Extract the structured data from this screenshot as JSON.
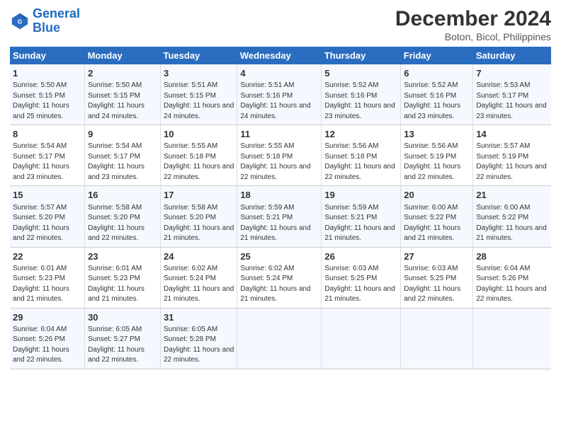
{
  "logo": {
    "line1": "General",
    "line2": "Blue"
  },
  "title": "December 2024",
  "subtitle": "Boton, Bicol, Philippines",
  "days_of_week": [
    "Sunday",
    "Monday",
    "Tuesday",
    "Wednesday",
    "Thursday",
    "Friday",
    "Saturday"
  ],
  "weeks": [
    [
      {
        "num": "1",
        "sunrise": "5:50 AM",
        "sunset": "5:15 PM",
        "daylight": "11 hours and 25 minutes."
      },
      {
        "num": "2",
        "sunrise": "5:50 AM",
        "sunset": "5:15 PM",
        "daylight": "11 hours and 24 minutes."
      },
      {
        "num": "3",
        "sunrise": "5:51 AM",
        "sunset": "5:15 PM",
        "daylight": "11 hours and 24 minutes."
      },
      {
        "num": "4",
        "sunrise": "5:51 AM",
        "sunset": "5:16 PM",
        "daylight": "11 hours and 24 minutes."
      },
      {
        "num": "5",
        "sunrise": "5:52 AM",
        "sunset": "5:16 PM",
        "daylight": "11 hours and 23 minutes."
      },
      {
        "num": "6",
        "sunrise": "5:52 AM",
        "sunset": "5:16 PM",
        "daylight": "11 hours and 23 minutes."
      },
      {
        "num": "7",
        "sunrise": "5:53 AM",
        "sunset": "5:17 PM",
        "daylight": "11 hours and 23 minutes."
      }
    ],
    [
      {
        "num": "8",
        "sunrise": "5:54 AM",
        "sunset": "5:17 PM",
        "daylight": "11 hours and 23 minutes."
      },
      {
        "num": "9",
        "sunrise": "5:54 AM",
        "sunset": "5:17 PM",
        "daylight": "11 hours and 23 minutes."
      },
      {
        "num": "10",
        "sunrise": "5:55 AM",
        "sunset": "5:18 PM",
        "daylight": "11 hours and 22 minutes."
      },
      {
        "num": "11",
        "sunrise": "5:55 AM",
        "sunset": "5:18 PM",
        "daylight": "11 hours and 22 minutes."
      },
      {
        "num": "12",
        "sunrise": "5:56 AM",
        "sunset": "5:18 PM",
        "daylight": "11 hours and 22 minutes."
      },
      {
        "num": "13",
        "sunrise": "5:56 AM",
        "sunset": "5:19 PM",
        "daylight": "11 hours and 22 minutes."
      },
      {
        "num": "14",
        "sunrise": "5:57 AM",
        "sunset": "5:19 PM",
        "daylight": "11 hours and 22 minutes."
      }
    ],
    [
      {
        "num": "15",
        "sunrise": "5:57 AM",
        "sunset": "5:20 PM",
        "daylight": "11 hours and 22 minutes."
      },
      {
        "num": "16",
        "sunrise": "5:58 AM",
        "sunset": "5:20 PM",
        "daylight": "11 hours and 22 minutes."
      },
      {
        "num": "17",
        "sunrise": "5:58 AM",
        "sunset": "5:20 PM",
        "daylight": "11 hours and 21 minutes."
      },
      {
        "num": "18",
        "sunrise": "5:59 AM",
        "sunset": "5:21 PM",
        "daylight": "11 hours and 21 minutes."
      },
      {
        "num": "19",
        "sunrise": "5:59 AM",
        "sunset": "5:21 PM",
        "daylight": "11 hours and 21 minutes."
      },
      {
        "num": "20",
        "sunrise": "6:00 AM",
        "sunset": "5:22 PM",
        "daylight": "11 hours and 21 minutes."
      },
      {
        "num": "21",
        "sunrise": "6:00 AM",
        "sunset": "5:22 PM",
        "daylight": "11 hours and 21 minutes."
      }
    ],
    [
      {
        "num": "22",
        "sunrise": "6:01 AM",
        "sunset": "5:23 PM",
        "daylight": "11 hours and 21 minutes."
      },
      {
        "num": "23",
        "sunrise": "6:01 AM",
        "sunset": "5:23 PM",
        "daylight": "11 hours and 21 minutes."
      },
      {
        "num": "24",
        "sunrise": "6:02 AM",
        "sunset": "5:24 PM",
        "daylight": "11 hours and 21 minutes."
      },
      {
        "num": "25",
        "sunrise": "6:02 AM",
        "sunset": "5:24 PM",
        "daylight": "11 hours and 21 minutes."
      },
      {
        "num": "26",
        "sunrise": "6:03 AM",
        "sunset": "5:25 PM",
        "daylight": "11 hours and 21 minutes."
      },
      {
        "num": "27",
        "sunrise": "6:03 AM",
        "sunset": "5:25 PM",
        "daylight": "11 hours and 22 minutes."
      },
      {
        "num": "28",
        "sunrise": "6:04 AM",
        "sunset": "5:26 PM",
        "daylight": "11 hours and 22 minutes."
      }
    ],
    [
      {
        "num": "29",
        "sunrise": "6:04 AM",
        "sunset": "5:26 PM",
        "daylight": "11 hours and 22 minutes."
      },
      {
        "num": "30",
        "sunrise": "6:05 AM",
        "sunset": "5:27 PM",
        "daylight": "11 hours and 22 minutes."
      },
      {
        "num": "31",
        "sunrise": "6:05 AM",
        "sunset": "5:28 PM",
        "daylight": "11 hours and 22 minutes."
      },
      null,
      null,
      null,
      null
    ]
  ]
}
